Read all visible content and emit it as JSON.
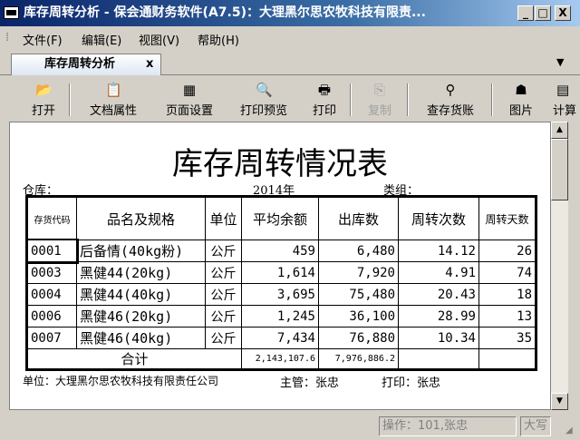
{
  "window": {
    "title": "库存周转分析 - 保会通财务软件(A7.5)：大理黑尔思农牧科技有限责...",
    "min": "_",
    "max": "□",
    "close": "X"
  },
  "menu": [
    "文件(F)",
    "编辑(E)",
    "视图(V)",
    "帮助(H)"
  ],
  "tab": {
    "label": "库存周转分析",
    "close": "x",
    "overflow": "▼"
  },
  "toolbar": [
    {
      "label": "打开",
      "icon": "open-folder-icon",
      "glyph": "📂"
    },
    {
      "label": "文档属性",
      "icon": "document-properties-icon",
      "glyph": "📋"
    },
    {
      "label": "页面设置",
      "icon": "page-setup-icon",
      "glyph": "▦"
    },
    {
      "label": "打印预览",
      "icon": "print-preview-icon",
      "glyph": "🔍"
    },
    {
      "label": "打印",
      "icon": "printer-icon",
      "glyph": "🖶"
    },
    {
      "label": "复制",
      "icon": "copy-icon",
      "glyph": "⎘",
      "disabled": true
    },
    {
      "label": "查存货账",
      "icon": "magnifier-icon",
      "glyph": "⚲"
    },
    {
      "label": "图片",
      "icon": "picture-icon",
      "glyph": "☗"
    },
    {
      "label": "计算",
      "icon": "calculator-icon",
      "glyph": "▤"
    }
  ],
  "report": {
    "title": "库存周转情况表",
    "warehouse_label": "仓库：",
    "year": "2014年",
    "category_label": "类组：",
    "headers": [
      "存货代码",
      "品名及规格",
      "单位",
      "平均余额",
      "出库数",
      "周转次数",
      "周转天数"
    ],
    "rows": [
      [
        "0001",
        "后备情(40kg粉)",
        "公斤",
        "459",
        "6,480",
        "14.12",
        "26"
      ],
      [
        "0003",
        "黑健44(20kg)",
        "公斤",
        "1,614",
        "7,920",
        "4.91",
        "74"
      ],
      [
        "0004",
        "黑健44(40kg)",
        "公斤",
        "3,695",
        "75,480",
        "20.43",
        "18"
      ],
      [
        "0006",
        "黑健46(20kg)",
        "公斤",
        "1,245",
        "36,100",
        "28.99",
        "13"
      ],
      [
        "0007",
        "黑健46(40kg)",
        "公斤",
        "7,434",
        "76,880",
        "10.34",
        "35"
      ]
    ],
    "total_label": "合计",
    "total_avg": "2,143,107.6",
    "total_out": "7,976,886.2",
    "footer_unit": "单位：大理黑尔思农牧科技有限责任公司",
    "footer_supervisor": "主管：张忠",
    "footer_printer": "打印：张忠"
  },
  "status": {
    "operator": "操作：101,张忠",
    "caps": "大写"
  }
}
